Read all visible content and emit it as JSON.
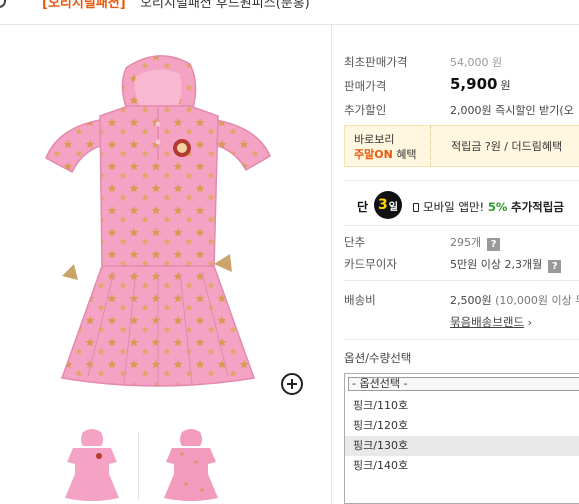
{
  "header": {
    "title_bracket": "[오리지널패션]",
    "title_text": "오리지널패션 후드원피스(분홍)"
  },
  "product": {
    "main_image_alt": "pink hooded star dress",
    "thumbnails": [
      "thumb-front",
      "thumb-back"
    ]
  },
  "info": {
    "original_price_label": "최초판매가격",
    "original_price_value": "54,000 원",
    "sale_price_label": "판매가격",
    "sale_price_value": "5,900",
    "sale_price_unit": "원",
    "extra_discount_label": "추가할인",
    "extra_discount_value": "2,000원 즉시할인 받기(오",
    "promo_line1": "바로보리",
    "promo_highlight": "주말ON",
    "promo_line2_tail": "혜택",
    "promo_right": "적립금 ?원 / 더드림혜택",
    "mobile_dan": "단",
    "mobile_day": "3",
    "mobile_day_unit": "일",
    "mobile_text_pre": "모바일 앱만!",
    "mobile_pct": "5%",
    "mobile_text_post": "추가적립금",
    "dan_label": "단추",
    "dan_value": "295개",
    "card_label": "카드무이자",
    "card_value": "5만원 이상 2,3개월",
    "shipping_label": "배송비",
    "shipping_value": "2,500원",
    "shipping_note": "(10,000원 이상 무",
    "bundle_link": "묶음배송브랜드",
    "bundle_arrow": "›",
    "question_mark": "?",
    "options_label": "옵션/수량선택",
    "options": [
      "- 옵션선택 -",
      "핑크/110호",
      "핑크/120호",
      "핑크/130호",
      "핑크/140호"
    ]
  },
  "colors": {
    "accent": "#e8590c",
    "pink": "#f29bbd",
    "green": "#2a9d2a"
  }
}
